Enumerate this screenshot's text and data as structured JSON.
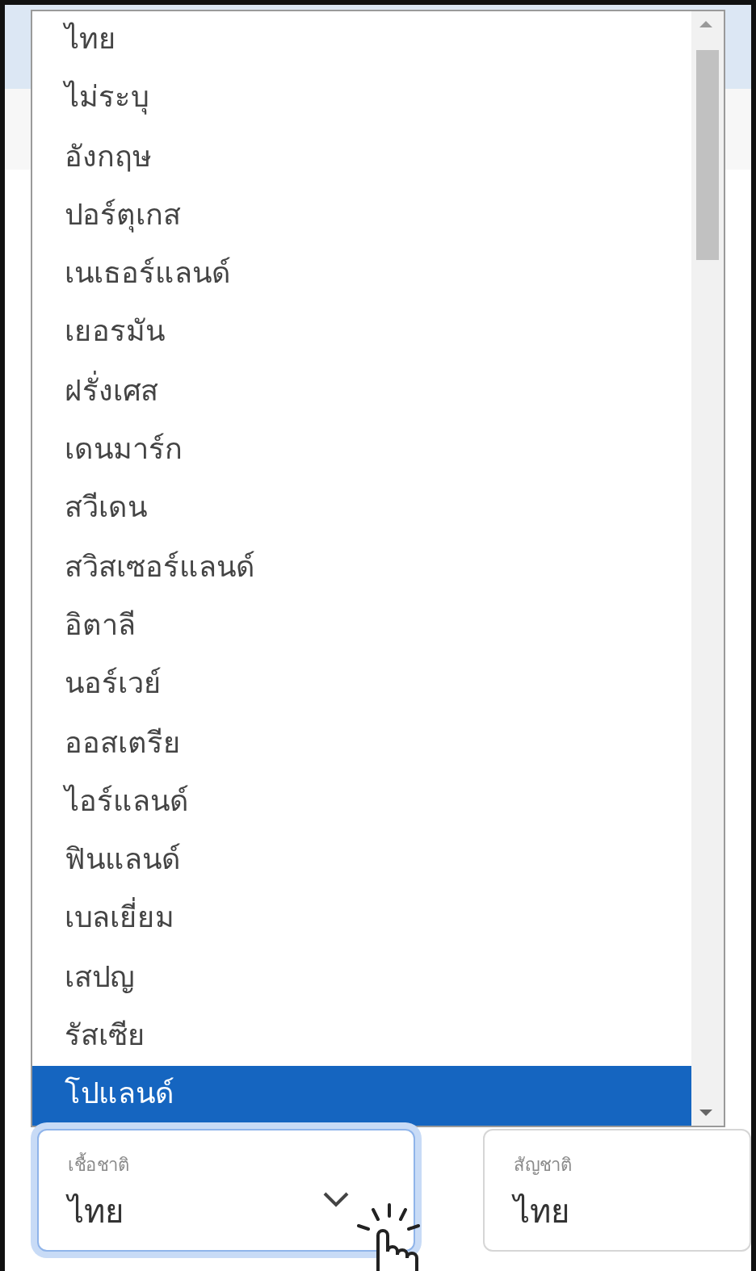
{
  "dropdown": {
    "options": [
      {
        "label": "ไทย",
        "selected": false
      },
      {
        "label": "ไม่ระบุ",
        "selected": false
      },
      {
        "label": "อังกฤษ",
        "selected": false
      },
      {
        "label": "ปอร์ตุเกส",
        "selected": false
      },
      {
        "label": "เนเธอร์แลนด์",
        "selected": false
      },
      {
        "label": "เยอรมัน",
        "selected": false
      },
      {
        "label": "ฝรั่งเศส",
        "selected": false
      },
      {
        "label": "เดนมาร์ก",
        "selected": false
      },
      {
        "label": "สวีเดน",
        "selected": false
      },
      {
        "label": "สวิสเซอร์แลนด์",
        "selected": false
      },
      {
        "label": "อิตาลี",
        "selected": false
      },
      {
        "label": "นอร์เวย์",
        "selected": false
      },
      {
        "label": "ออสเตรีย",
        "selected": false
      },
      {
        "label": "ไอร์แลนด์",
        "selected": false
      },
      {
        "label": "ฟินแลนด์",
        "selected": false
      },
      {
        "label": "เบลเยี่ยม",
        "selected": false
      },
      {
        "label": "เสปญ",
        "selected": false
      },
      {
        "label": "รัสเซีย",
        "selected": false
      },
      {
        "label": "โปแลนด์",
        "selected": true
      }
    ]
  },
  "fields": [
    {
      "kind": "select",
      "label": "เชื้อชาติ",
      "value": "ไทย",
      "focused": true
    },
    {
      "kind": "text",
      "label": "สัญชาติ",
      "value": "ไทย",
      "focused": false
    }
  ]
}
